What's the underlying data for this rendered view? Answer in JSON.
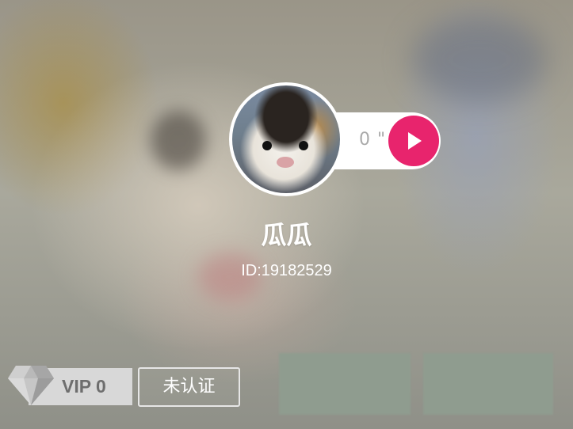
{
  "profile": {
    "nickname": "瓜瓜",
    "user_id": "ID:19182529",
    "voice_duration": "0 \"",
    "avatar_icon": "guinea-pig-avatar",
    "play_icon": "play-icon"
  },
  "badges": {
    "vip_label": "VIP 0",
    "vip_icon": "diamond-icon",
    "certification_label": "未认证"
  },
  "colors": {
    "accent": "#e8246d",
    "vip_bar": "#d8d8d8",
    "vip_text": "#6e6e6e",
    "overlay_block": "#8f9c8f"
  }
}
